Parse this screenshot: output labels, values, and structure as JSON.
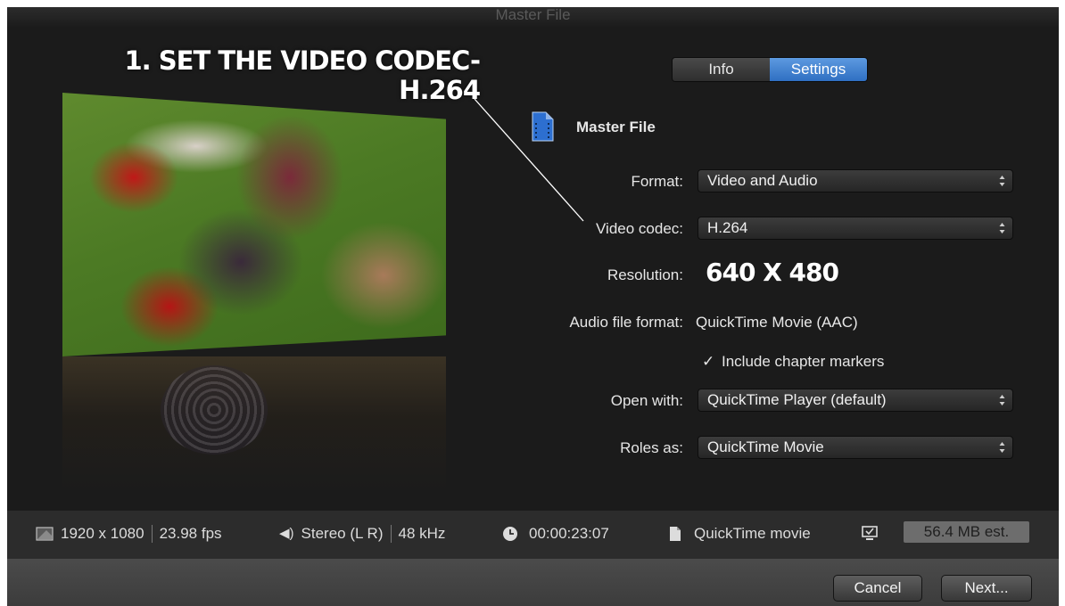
{
  "window": {
    "title": "Master File"
  },
  "annotation": {
    "line1": "1. SET THE VIDEO CODEC-",
    "line2": "H.264",
    "resolution_callout": "640 X 480"
  },
  "tabs": {
    "info": "Info",
    "settings": "Settings",
    "selected": "Settings"
  },
  "header": {
    "title": "Master File",
    "icon": "film-document-icon"
  },
  "form": {
    "format": {
      "label": "Format:",
      "value": "Video and Audio"
    },
    "video_codec": {
      "label": "Video codec:",
      "value": "H.264"
    },
    "resolution": {
      "label": "Resolution:"
    },
    "audio_file_format": {
      "label": "Audio file format:",
      "value": "QuickTime Movie (AAC)"
    },
    "chapter_markers": {
      "label": "Include chapter markers",
      "checked": true
    },
    "open_with": {
      "label": "Open with:",
      "value": "QuickTime Player (default)"
    },
    "roles_as": {
      "label": "Roles as:",
      "value": "QuickTime Movie"
    }
  },
  "info_bar": {
    "resolution": "1920 x 1080",
    "fps": "23.98 fps",
    "audio_channels": "Stereo (L R)",
    "sample_rate": "48 kHz",
    "duration": "00:00:23:07",
    "file_type": "QuickTime movie",
    "estimated_size": "56.4 MB est."
  },
  "buttons": {
    "cancel": "Cancel",
    "next": "Next..."
  },
  "colors": {
    "window_bg": "#1b1b1b",
    "accent_blue": "#3a7bd5",
    "info_bar_bg": "#2c2c2c",
    "bottom_bar_bg": "#444444"
  }
}
